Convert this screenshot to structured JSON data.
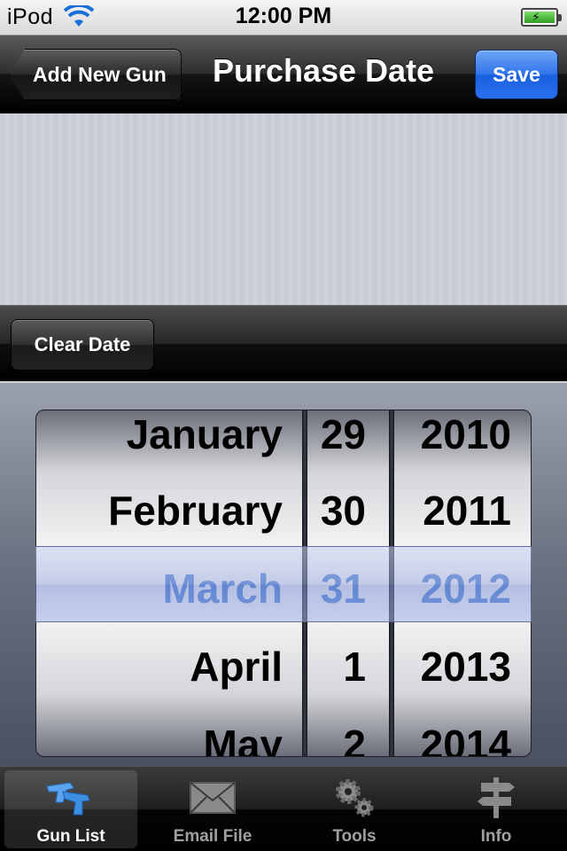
{
  "status_bar": {
    "carrier": "iPod",
    "time": "12:00 PM",
    "wifi_icon": "wifi-icon",
    "battery_icon": "battery-charging-icon"
  },
  "nav_bar": {
    "back_label": "Add New Gun",
    "title": "Purchase Date",
    "save_label": "Save",
    "save_color": "#2f74e8"
  },
  "toolbar": {
    "clear_label": "Clear Date"
  },
  "picker": {
    "months": [
      "January",
      "February",
      "March",
      "April",
      "May"
    ],
    "days": [
      "29",
      "30",
      "31",
      "1",
      "2"
    ],
    "years": [
      "2010",
      "2011",
      "2012",
      "2013",
      "2014"
    ],
    "selected_month": "March",
    "selected_day": "31",
    "selected_year": "2012",
    "selected_color": "#4a7fd6"
  },
  "tab_bar": {
    "tabs": [
      {
        "label": "Gun List",
        "icon": "pistols-icon",
        "active": true
      },
      {
        "label": "Email File",
        "icon": "envelope-icon",
        "active": false
      },
      {
        "label": "Tools",
        "icon": "gears-icon",
        "active": false
      },
      {
        "label": "Info",
        "icon": "signpost-icon",
        "active": false
      }
    ]
  }
}
